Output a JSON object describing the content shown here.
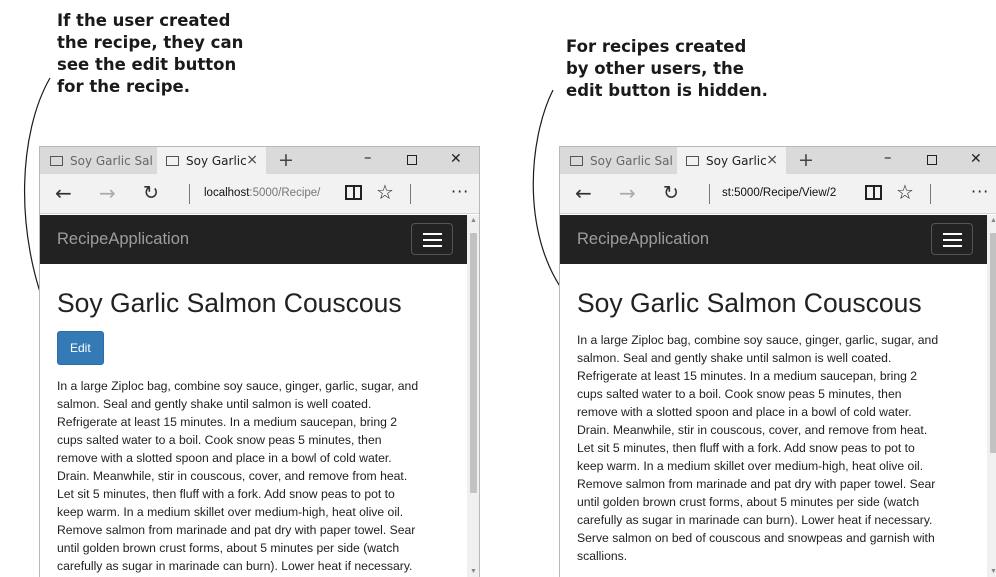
{
  "callouts": {
    "left": [
      "If the user created",
      "the recipe, they can",
      "see the edit button",
      "for the recipe."
    ],
    "right": [
      "For recipes created",
      "by other users, the",
      "edit button is hidden."
    ]
  },
  "left_browser": {
    "tabs": {
      "inactive": "Soy Garlic Sal",
      "active": "Soy Garlic"
    },
    "url": {
      "host": "localhost",
      "path": ":5000/Recipe/"
    },
    "brand": "RecipeApplication",
    "title": "Soy Garlic Salmon Couscous",
    "edit_label": "Edit",
    "instructions": [
      "In a large Ziploc bag, combine soy sauce, ginger, garlic, sugar, and",
      "salmon. Seal and gently shake until salmon is well coated.",
      "Refrigerate at least 15 minutes. In a medium saucepan, bring 2",
      "cups salted water to a boil. Cook snow peas 5 minutes, then",
      "remove with a slotted spoon and place in a bowl of cold water.",
      "Drain. Meanwhile, stir in couscous, cover, and remove from heat.",
      "Let sit 5 minutes, then fluff with a fork. Add snow peas to pot to",
      "keep warm. In a medium skillet over medium-high, heat olive oil.",
      "Remove salmon from marinade and pat dry with paper towel. Sear",
      "until golden brown crust forms, about 5 minutes per side (watch",
      "carefully as sugar in marinade can burn). Lower heat if necessary."
    ]
  },
  "right_browser": {
    "tabs": {
      "inactive": "Soy Garlic Sal",
      "active": "Soy Garlic"
    },
    "url": {
      "host": "",
      "path": "st:5000/Recipe/View/2"
    },
    "brand": "RecipeApplication",
    "title": "Soy Garlic Salmon Couscous",
    "instructions": [
      "In a large Ziploc bag, combine soy sauce, ginger, garlic, sugar, and",
      "salmon. Seal and gently shake until salmon is well coated.",
      "Refrigerate at least 15 minutes. In a medium saucepan, bring 2",
      "cups salted water to a boil. Cook snow peas 5 minutes, then",
      "remove with a slotted spoon and place in a bowl of cold water.",
      "Drain. Meanwhile, stir in couscous, cover, and remove from heat.",
      "Let sit 5 minutes, then fluff with a fork. Add snow peas to pot to",
      "keep warm. In a medium skillet over medium-high, heat olive oil.",
      "Remove salmon from marinade and pat dry with paper towel. Sear",
      "until golden brown crust forms, about 5 minutes per side (watch",
      "carefully as sugar in marinade can burn). Lower heat if necessary.",
      "Serve salmon on bed of couscous and snowpeas and garnish with",
      "scallions."
    ]
  },
  "icons": {
    "tab": "tab-icon",
    "tab_close": "×",
    "new_tab": "+",
    "minimize": "–",
    "close": "✕",
    "back": "←",
    "forward": "→",
    "refresh": "↻",
    "favorite": "☆",
    "more": "···"
  },
  "colors": {
    "navbar": "#222222",
    "button": "#337ab7",
    "brand_text": "#9d9d9d"
  }
}
